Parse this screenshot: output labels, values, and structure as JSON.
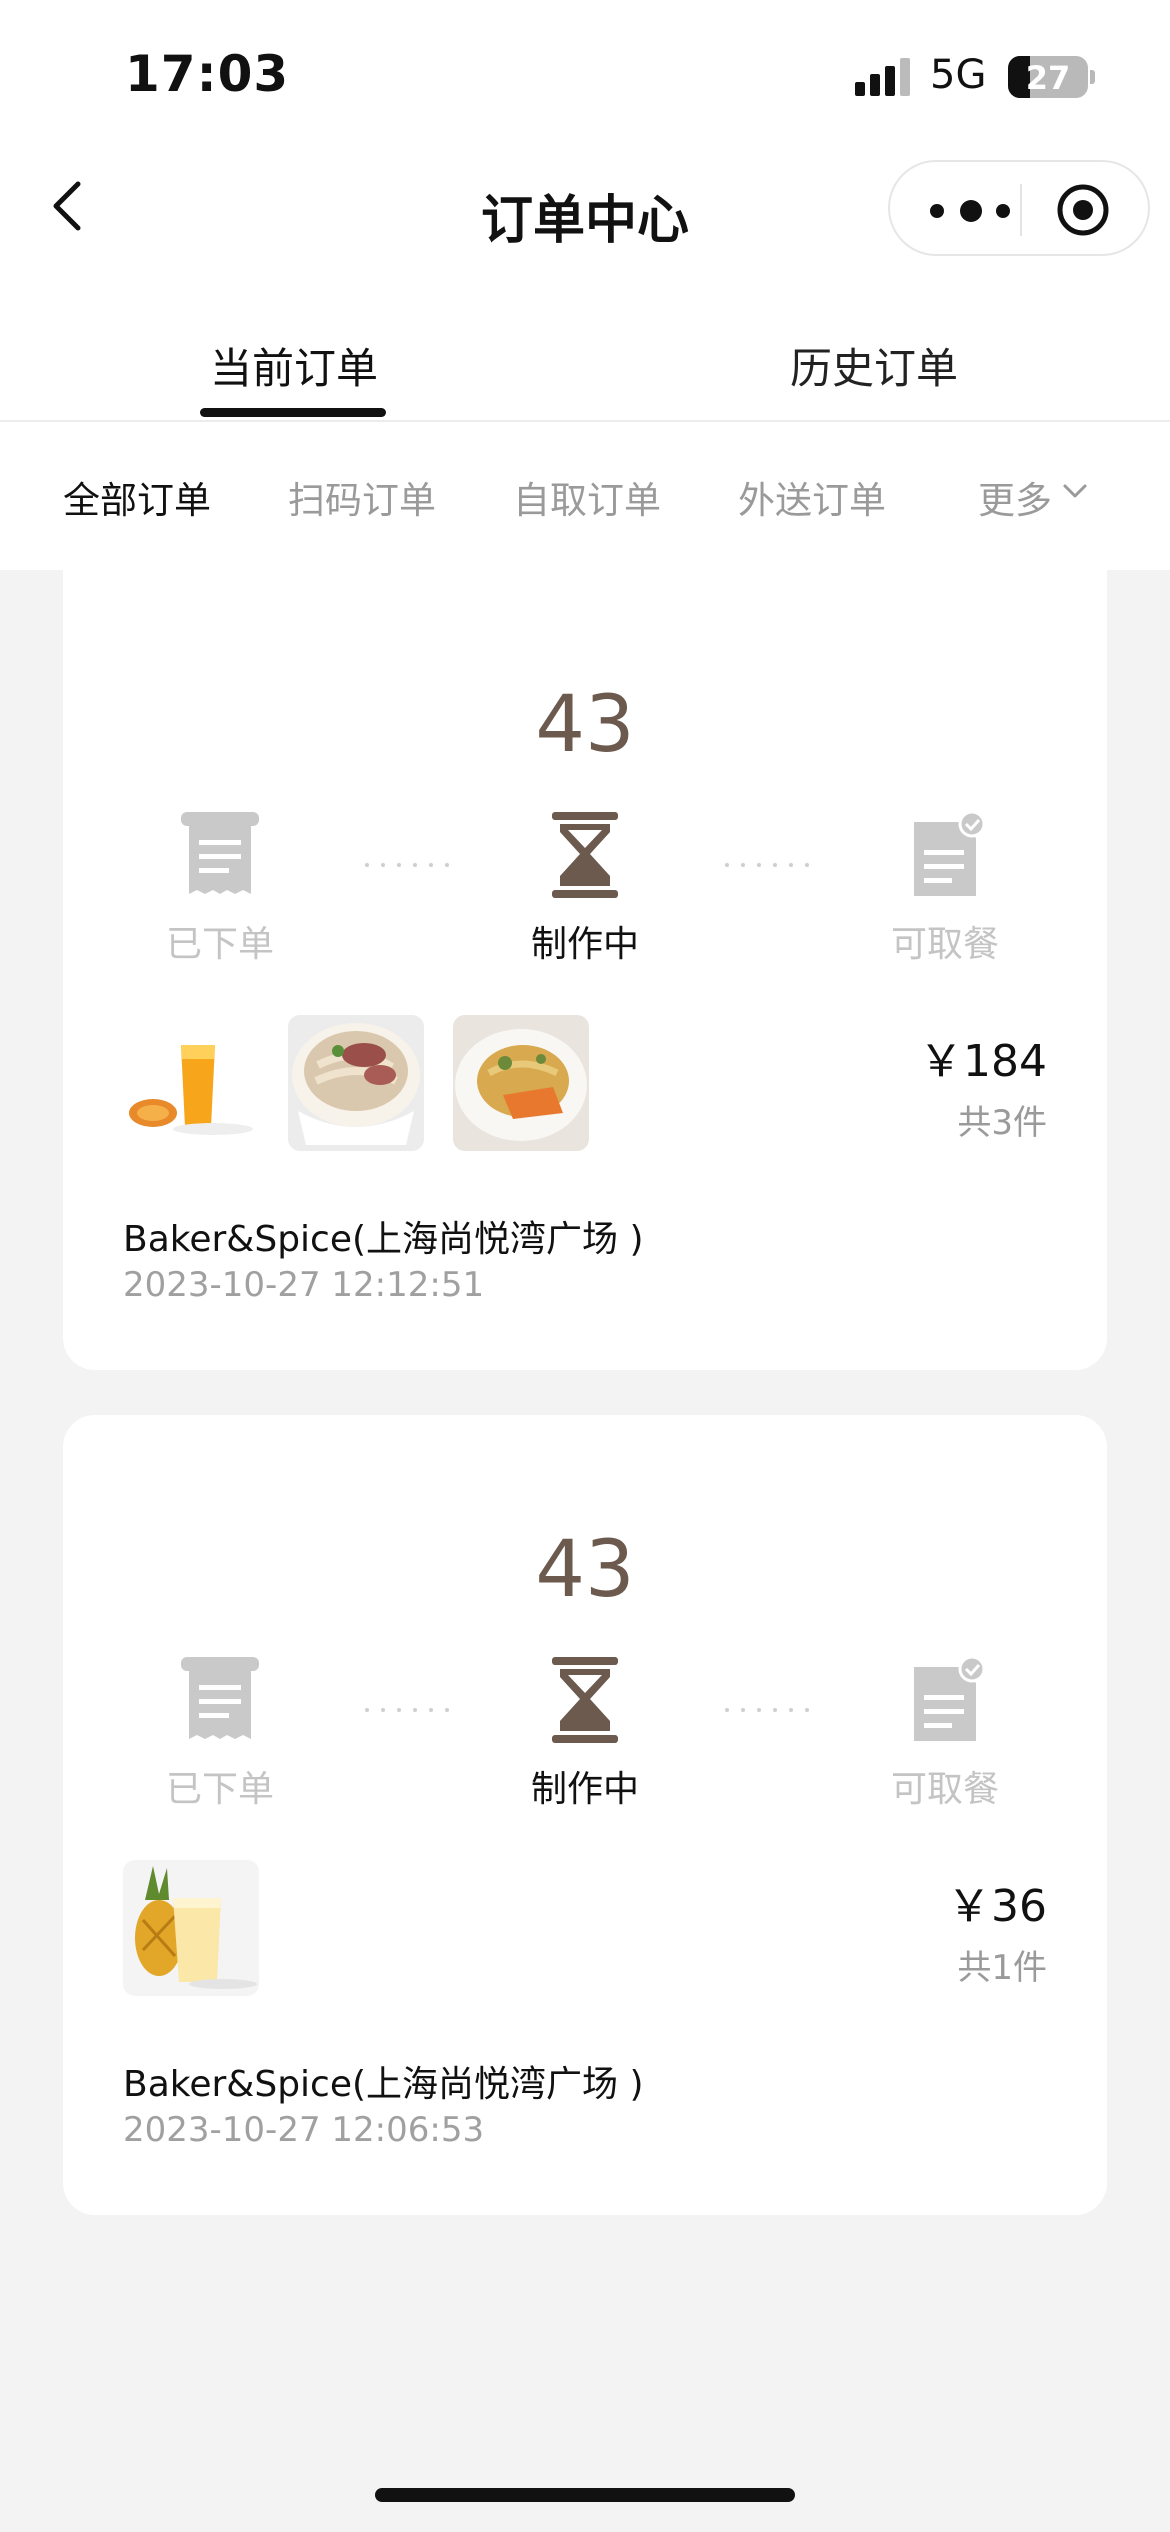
{
  "status_bar": {
    "time": "17:03",
    "network": "5G",
    "battery": "27",
    "battery_level": 0.27
  },
  "nav": {
    "title": "订单中心"
  },
  "tabs": [
    {
      "label": "当前订单",
      "active": true
    },
    {
      "label": "历史订单",
      "active": false
    }
  ],
  "filters": [
    {
      "label": "全部订单",
      "active": true
    },
    {
      "label": "扫码订单",
      "active": false
    },
    {
      "label": "自取订单",
      "active": false
    },
    {
      "label": "外送订单",
      "active": false
    },
    {
      "label": "更多",
      "active": false
    }
  ],
  "steps": [
    "已下单",
    "制作中",
    "可取餐"
  ],
  "orders": [
    {
      "pickup_number": "43",
      "current_step": "制作中",
      "price": "￥184",
      "count": "共3件",
      "store": "Baker&Spice(上海尚悦湾广场 )",
      "datetime": "2023-10-27 12:12:51",
      "items": [
        "papaya-orange-juice",
        "beef-noodle-soup",
        "salmon-pasta"
      ]
    },
    {
      "pickup_number": "43",
      "current_step": "制作中",
      "price": "￥36",
      "count": "共1件",
      "store": "Baker&Spice(上海尚悦湾广场 )",
      "datetime": "2023-10-27 12:06:53",
      "items": [
        "pineapple-juice"
      ]
    }
  ],
  "colors": {
    "accent_brown": "#6b5a4d",
    "inactive_gray": "#c4c4c4",
    "page_bg": "#f3f3f3"
  }
}
